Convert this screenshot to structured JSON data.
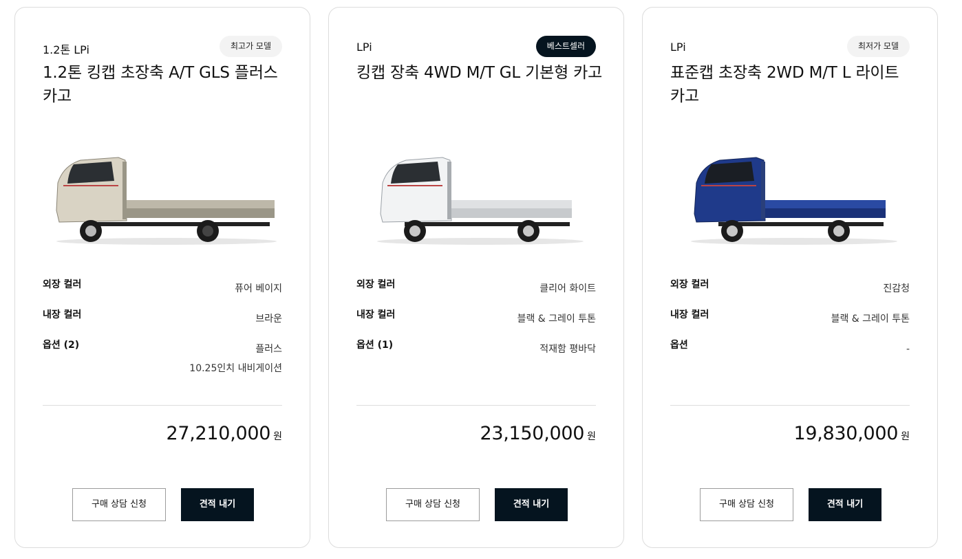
{
  "cards": [
    {
      "fuel": "1.2톤 LPi",
      "badge": "최고가 모델",
      "badge_style": "light",
      "title": "1.2톤 킹캡 초장축 A/T GLS 플러스 카고",
      "truck_color": "#d9d3c4",
      "specs": {
        "exterior_label": "외장 컬러",
        "exterior_value": "퓨어 베이지",
        "interior_label": "내장 컬러",
        "interior_value": "브라운",
        "option_label": "옵션 (2)",
        "option_values": [
          "플러스",
          "10.25인치 내비게이션"
        ]
      },
      "price": "27,210,000",
      "unit": "원",
      "consult_label": "구매 상담 신청",
      "quote_label": "견적 내기"
    },
    {
      "fuel": "LPi",
      "badge": "베스트셀러",
      "badge_style": "dark",
      "title": "킹캡 장축 4WD M/T GL 기본형 카고",
      "truck_color": "#f2f3f4",
      "specs": {
        "exterior_label": "외장 컬러",
        "exterior_value": "클리어 화이트",
        "interior_label": "내장 컬러",
        "interior_value": "블랙 & 그레이 투톤",
        "option_label": "옵션 (1)",
        "option_values": [
          "적재함 평바닥"
        ]
      },
      "price": "23,150,000",
      "unit": "원",
      "consult_label": "구매 상담 신청",
      "quote_label": "견적 내기"
    },
    {
      "fuel": "LPi",
      "badge": "최저가 모델",
      "badge_style": "light",
      "title": "표준캡 초장축 2WD M/T L 라이트 카고",
      "truck_color": "#1f3a8a",
      "specs": {
        "exterior_label": "외장 컬러",
        "exterior_value": "진감청",
        "interior_label": "내장 컬러",
        "interior_value": "블랙 & 그레이 투톤",
        "option_label": "옵션",
        "option_values": [
          "-"
        ]
      },
      "price": "19,830,000",
      "unit": "원",
      "consult_label": "구매 상담 신청",
      "quote_label": "견적 내기"
    }
  ],
  "colors": {
    "primary_dark": "#05141f",
    "border": "#dcdcdc",
    "badge_light": "#f3f3f3"
  },
  "icons": [
    "truck-image"
  ]
}
